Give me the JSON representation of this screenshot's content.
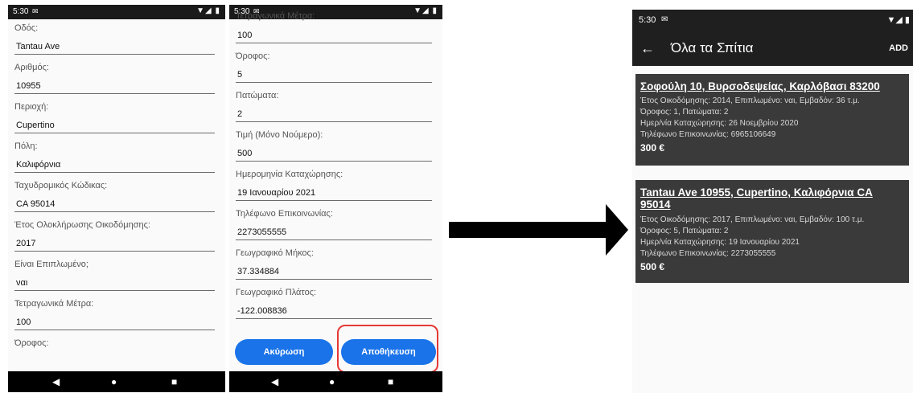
{
  "status": {
    "time": "5:30",
    "sms_icon": "message-icon",
    "icons": "▼◢ ▮"
  },
  "phone1": {
    "fields": [
      {
        "label": "Οδός:",
        "value": "Tantau Ave"
      },
      {
        "label": "Αριθμός:",
        "value": "10955"
      },
      {
        "label": "Περιοχή:",
        "value": "Cupertino"
      },
      {
        "label": "Πόλη:",
        "value": "Καλιφόρνια"
      },
      {
        "label": "Ταχυδρομικός Κώδικας:",
        "value": "CA 95014"
      },
      {
        "label": "Έτος Ολοκλήρωσης Οικοδόμησης:",
        "value": "2017"
      },
      {
        "label": "Είναι Επιπλωμένο;",
        "value": "ναι"
      },
      {
        "label": "Τετραγωνικά Μέτρα:",
        "value": "100"
      },
      {
        "label": "Όροφος:",
        "value": ""
      }
    ]
  },
  "phone2": {
    "fields": [
      {
        "label": "Τετραγωνικά Μέτρα:",
        "value": "100"
      },
      {
        "label": "Όροφος:",
        "value": "5"
      },
      {
        "label": "Πατώματα:",
        "value": "2"
      },
      {
        "label": "Τιμή (Μόνο Νούμερο):",
        "value": "500"
      },
      {
        "label": "Ημερομηνία Καταχώρησης:",
        "value": "19 Ιανουαρίου 2021"
      },
      {
        "label": "Τηλέφωνο Επικοινωνίας:",
        "value": "2273055555"
      },
      {
        "label": "Γεωγραφικό Μήκος:",
        "value": "37.334884"
      },
      {
        "label": "Γεωγραφικό Πλάτος:",
        "value": "-122.008836"
      }
    ],
    "cancel_label": "Ακύρωση",
    "save_label": "Αποθήκευση",
    "highlight_color": "#e53935"
  },
  "navbar": {
    "back": "◀",
    "home": "●",
    "recents": "■"
  },
  "list_screen": {
    "back_arrow": "←",
    "title": "Όλα τα Σπίτια",
    "add_label": "ADD",
    "cards": [
      {
        "address": "Σοφούλη 10, Βυρσοδεψείας, Καρλόβασι 83200",
        "line1": "Έτος Οικοδόμησης: 2014, Επιπλωμένο: ναι, Εμβαδόν: 36 τ.μ.",
        "line2": "Όροφος: 1, Πατώματα: 2",
        "line3": "Ημερ/νία Καταχώρησης: 26 Νοεμβρίου 2020",
        "line4": "Τηλέφωνο Επικοινωνίας: 6965106649",
        "price": "300 €"
      },
      {
        "address": "Tantau Ave 10955, Cupertino, Καλιφόρνια CA 95014",
        "line1": "Έτος Οικοδόμησης: 2017, Επιπλωμένο: ναι, Εμβαδόν: 100 τ.μ.",
        "line2": "Όροφος: 5, Πατώματα: 2",
        "line3": "Ημερ/νία Καταχώρησης: 19 Ιανουαρίου 2021",
        "line4": "Τηλέφωνο Επικοινωνίας: 2273055555",
        "price": "500 €"
      }
    ]
  }
}
